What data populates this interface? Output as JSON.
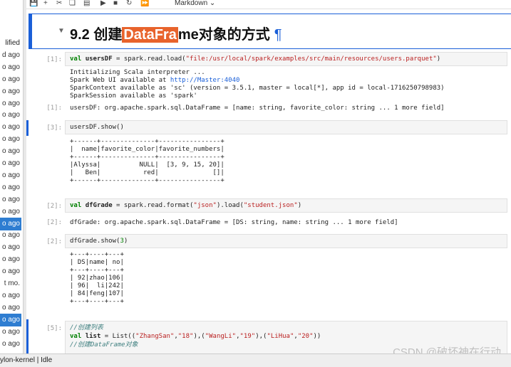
{
  "left_list": [
    {
      "label": "lified",
      "sel": false,
      "hdr": true
    },
    {
      "label": "d ago",
      "sel": false
    },
    {
      "label": "o ago",
      "sel": false
    },
    {
      "label": "o ago",
      "sel": false
    },
    {
      "label": "o ago",
      "sel": false
    },
    {
      "label": "o ago",
      "sel": false
    },
    {
      "label": "o ago",
      "sel": false
    },
    {
      "label": "o ago",
      "sel": false
    },
    {
      "label": "o ago",
      "sel": false
    },
    {
      "label": "o ago",
      "sel": false
    },
    {
      "label": "o ago",
      "sel": false
    },
    {
      "label": "o ago",
      "sel": false
    },
    {
      "label": "o ago",
      "sel": false
    },
    {
      "label": "o ago",
      "sel": false
    },
    {
      "label": "o ago",
      "sel": false
    },
    {
      "label": "o ago",
      "sel": true
    },
    {
      "label": "o ago",
      "sel": false
    },
    {
      "label": "o ago",
      "sel": false
    },
    {
      "label": "o ago",
      "sel": false
    },
    {
      "label": "o ago",
      "sel": false
    },
    {
      "label": "t mo.",
      "sel": false
    },
    {
      "label": "o ago",
      "sel": false
    },
    {
      "label": "o ago",
      "sel": false
    },
    {
      "label": "o ago",
      "sel": true
    },
    {
      "label": "o ago",
      "sel": false
    },
    {
      "label": "o ago",
      "sel": false
    }
  ],
  "toolbar": {
    "icons": [
      "save-icon",
      "plus-icon",
      "cut-icon",
      "copy-icon",
      "paste-icon",
      "run-icon",
      "stop-icon",
      "restart-icon",
      "fast-forward-icon"
    ],
    "cell_type": "Markdown"
  },
  "heading": {
    "before": "9.2 创建",
    "highlight": "DataFra",
    "after": "me对象的方式",
    "pilcrow": "¶"
  },
  "cells": {
    "c1": {
      "prompt": "[1]:",
      "out_prompt": "[1]:"
    },
    "c3": {
      "prompt": "[3]:"
    },
    "c2": {
      "prompt": "[2]:",
      "out_prompt": "[2]:"
    },
    "c2b": {
      "prompt": "[2]:"
    },
    "c5": {
      "prompt": "[5]:"
    }
  },
  "c1_code": {
    "kw": "val",
    "var": "usersDF",
    "rest": " = spark.read.load(",
    "str": "\"file:/usr/local/spark/examples/src/main/resources/users.parquet\"",
    "end": ")"
  },
  "c1_out": {
    "line1": "Intitializing Scala interpreter ...",
    "line2a": "Spark Web UI available at ",
    "line2b": "http://Master:4040",
    "line3": "SparkContext available as 'sc' (version = 3.5.1, master = local[*], app id = local-1716250798983)",
    "line4": "SparkSession available as 'spark'",
    "result": "usersDF: org.apache.spark.sql.DataFrame = [name: string, favorite_color: string ... 1 more field]"
  },
  "c3_code": "usersDF.show()",
  "c3_out": "+------+--------------+----------------+\n|  name|favorite_color|favorite_numbers|\n+------+--------------+----------------+\n|Alyssa|          NULL|  [3, 9, 15, 20]|\n|   Ben|           red|              []|\n+------+--------------+----------------+",
  "c2_code": {
    "kw": "val",
    "var": "dfGrade",
    "rest1": " = spark.read.format(",
    "str1": "\"json\"",
    "rest2": ").load(",
    "str2": "\"student.json\"",
    "end": ")"
  },
  "c2_out": "dfGrade: org.apache.spark.sql.DataFrame = [DS: string, name: string ... 1 more field]",
  "c2b_code": {
    "text": "dfGrade.show(",
    "num": "3",
    "end": ")"
  },
  "c2b_out": "+---+----+---+\n| DS|name| no|\n+---+----+---+\n| 92|zhao|106|\n| 96|  li|242|\n| 84|feng|107|\n+---+----+---+",
  "c5_code": {
    "cmt1": "//创建列表",
    "kw": "val",
    "var": "list",
    "rest": " = List((",
    "s1": "\"ZhangSan\"",
    "s2": "\"18\"",
    "s3": "\"WangLi\"",
    "s4": "\"19\"",
    "s5": "\"LiHua\"",
    "s6": "\"20\"",
    "cmt2": "//创建DataFrame对象"
  },
  "status": "ylon-kernel | Idle",
  "watermark": "CSDN @破坏神在行动"
}
